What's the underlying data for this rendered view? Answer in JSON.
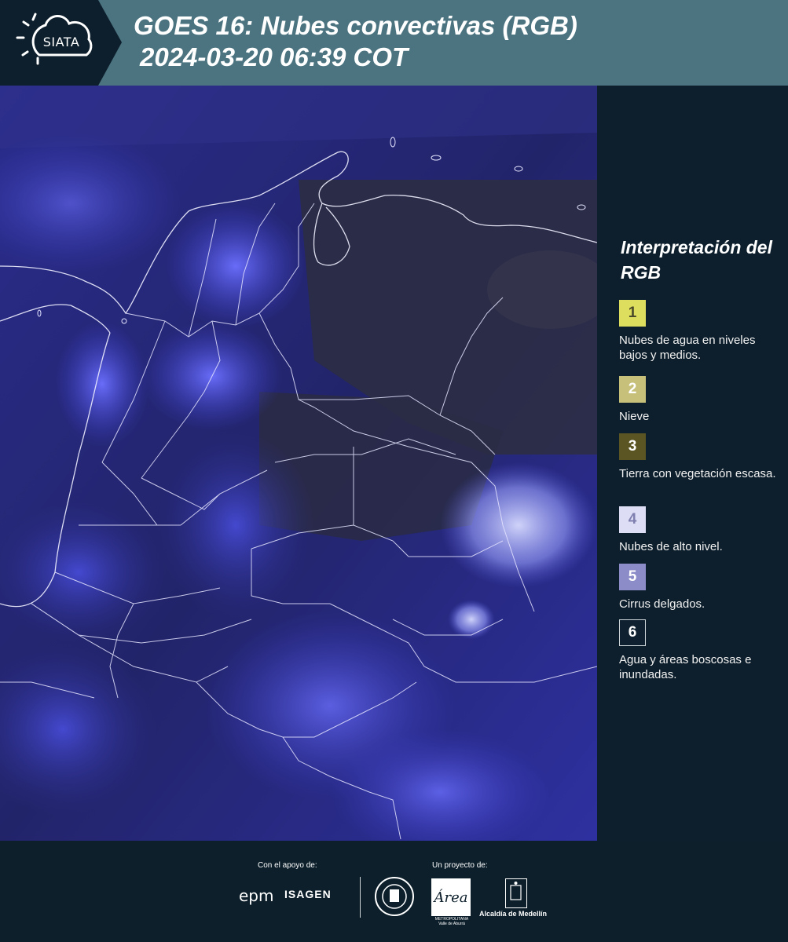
{
  "header": {
    "logo_text": "SIATA",
    "title_line1": "GOES 16: Nubes convectivas (RGB)",
    "title_line2": "2024-03-20 06:39 COT"
  },
  "legend": {
    "title": "Interpretación del RGB",
    "items": [
      {
        "number": "1",
        "color": "#dede5e",
        "text_color": "#4a4a2a",
        "label": "Nubes de agua en niveles bajos y medios."
      },
      {
        "number": "2",
        "color": "#c7c07a",
        "text_color": "#ffffff",
        "label": "Nieve"
      },
      {
        "number": "3",
        "color": "#5a5523",
        "text_color": "#ffffff",
        "label": "Tierra con vegetación escasa."
      },
      {
        "number": "4",
        "color": "#ddddf6",
        "text_color": "#8080b0",
        "label": "Nubes de alto nivel."
      },
      {
        "number": "5",
        "color": "#8c8cc9",
        "text_color": "#ffffff",
        "label": "Cirrus delgados."
      },
      {
        "number": "6",
        "color": "#0f2030",
        "text_color": "#ffffff",
        "label": "Agua y áreas boscosas e inundadas."
      }
    ]
  },
  "footer": {
    "support_label": "Con el apoyo de:",
    "project_label": "Un proyecto de:",
    "epm_logo": "epm",
    "isagen_logo": "ISAGEN",
    "area_logo_text": "METROPOLITANA Valle de Aburrá",
    "alcaldia_text": "Alcaldía de Medellín"
  },
  "colors": {
    "header_bg": "#4b7480",
    "panel_bg": "#0d1f2c",
    "cloud_blue": "#5a5cff",
    "dark_land": "#2a2c3e"
  }
}
